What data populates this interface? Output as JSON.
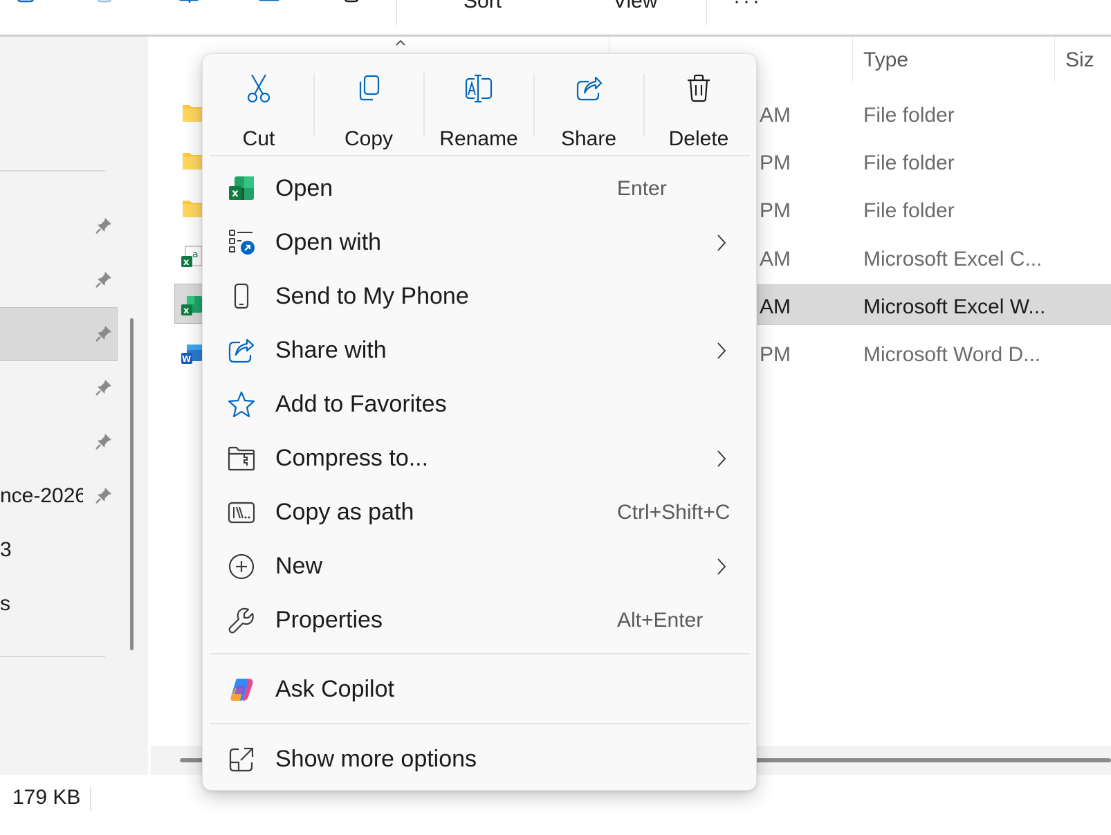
{
  "toolbar": {
    "sort_label": "Sort",
    "view_label": "View",
    "more_label": "···"
  },
  "nav": {
    "item_partial_1": "nce-2026",
    "item_partial_2": "3",
    "item_partial_3": "s"
  },
  "columns": {
    "type_header": "Type",
    "size_header": "Siz"
  },
  "rows": [
    {
      "time": "AM",
      "type": "File folder",
      "icon": "folder-icon"
    },
    {
      "time": "PM",
      "type": "File folder",
      "icon": "folder-icon"
    },
    {
      "time": "PM",
      "type": "File folder",
      "icon": "folder-icon"
    },
    {
      "time": "AM",
      "type": "Microsoft Excel C...",
      "icon": "excel-csv-icon"
    },
    {
      "time": "AM",
      "type": "Microsoft Excel W...",
      "icon": "excel-workbook-icon",
      "selected": true
    },
    {
      "time": "PM",
      "type": "Microsoft Word D...",
      "icon": "word-document-icon"
    }
  ],
  "status": {
    "size": "179 KB"
  },
  "context_menu": {
    "quick_actions": [
      {
        "label": "Cut",
        "icon": "scissors-icon"
      },
      {
        "label": "Copy",
        "icon": "copy-icon"
      },
      {
        "label": "Rename",
        "icon": "rename-icon"
      },
      {
        "label": "Share",
        "icon": "share-icon"
      },
      {
        "label": "Delete",
        "icon": "trash-icon"
      }
    ],
    "items": [
      {
        "label": "Open",
        "shortcut": "Enter",
        "icon": "excel-icon"
      },
      {
        "label": "Open with",
        "shortcut": "",
        "icon": "open-with-icon",
        "submenu": true
      },
      {
        "label": "Send to My Phone",
        "shortcut": "",
        "icon": "phone-icon"
      },
      {
        "label": "Share with",
        "shortcut": "",
        "icon": "share-icon",
        "submenu": true
      },
      {
        "label": "Add to Favorites",
        "shortcut": "",
        "icon": "star-icon"
      },
      {
        "label": "Compress to...",
        "shortcut": "",
        "icon": "zip-folder-icon",
        "submenu": true
      },
      {
        "label": "Copy as path",
        "shortcut": "Ctrl+Shift+C",
        "icon": "path-icon"
      },
      {
        "label": "New",
        "shortcut": "",
        "icon": "plus-circle-icon",
        "submenu": true
      },
      {
        "label": "Properties",
        "shortcut": "Alt+Enter",
        "icon": "wrench-icon"
      },
      {
        "label": "Ask Copilot",
        "shortcut": "",
        "icon": "copilot-icon"
      },
      {
        "label": "Show more options",
        "shortcut": "",
        "icon": "external-link-icon"
      }
    ]
  },
  "colors": {
    "accent": "#0067c0",
    "excel_green": "#107c41",
    "word_blue": "#185abd",
    "folder_yellow": "#ffc83d",
    "selection_gray": "#d9d9d9"
  }
}
